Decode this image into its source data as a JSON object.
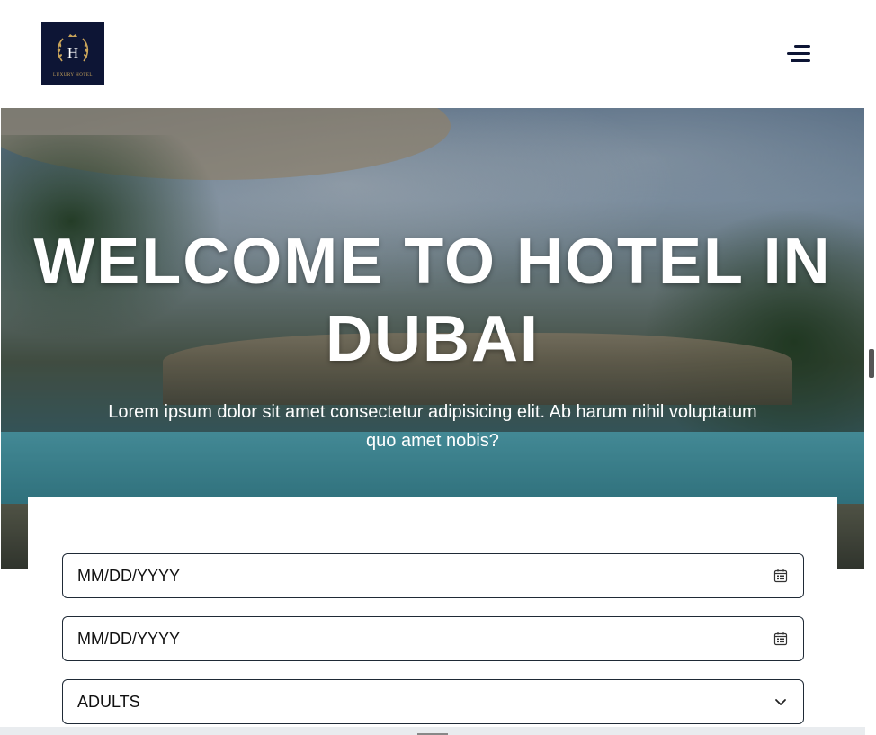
{
  "header": {
    "logo_letter": "H",
    "logo_text": "LUXURY HOTEL",
    "menu_icon": "hamburger-menu-icon"
  },
  "hero": {
    "title": "WELCOME TO HOTEL IN DUBAI",
    "subtitle": "Lorem ipsum dolor sit amet consectetur adipisicing elit. Ab harum nihil voluptatum quo amet nobis?"
  },
  "booking": {
    "checkin_value": "MM/DD/YYYY",
    "checkout_value": "MM/DD/YYYY",
    "adults_value": "ADULTS",
    "calendar_icon": "calendar-icon",
    "dropdown_icon": "chevron-down-icon"
  },
  "colors": {
    "logo_bg": "#0d1535",
    "logo_gold": "#c9a45a",
    "field_border": "#1f2a36"
  }
}
